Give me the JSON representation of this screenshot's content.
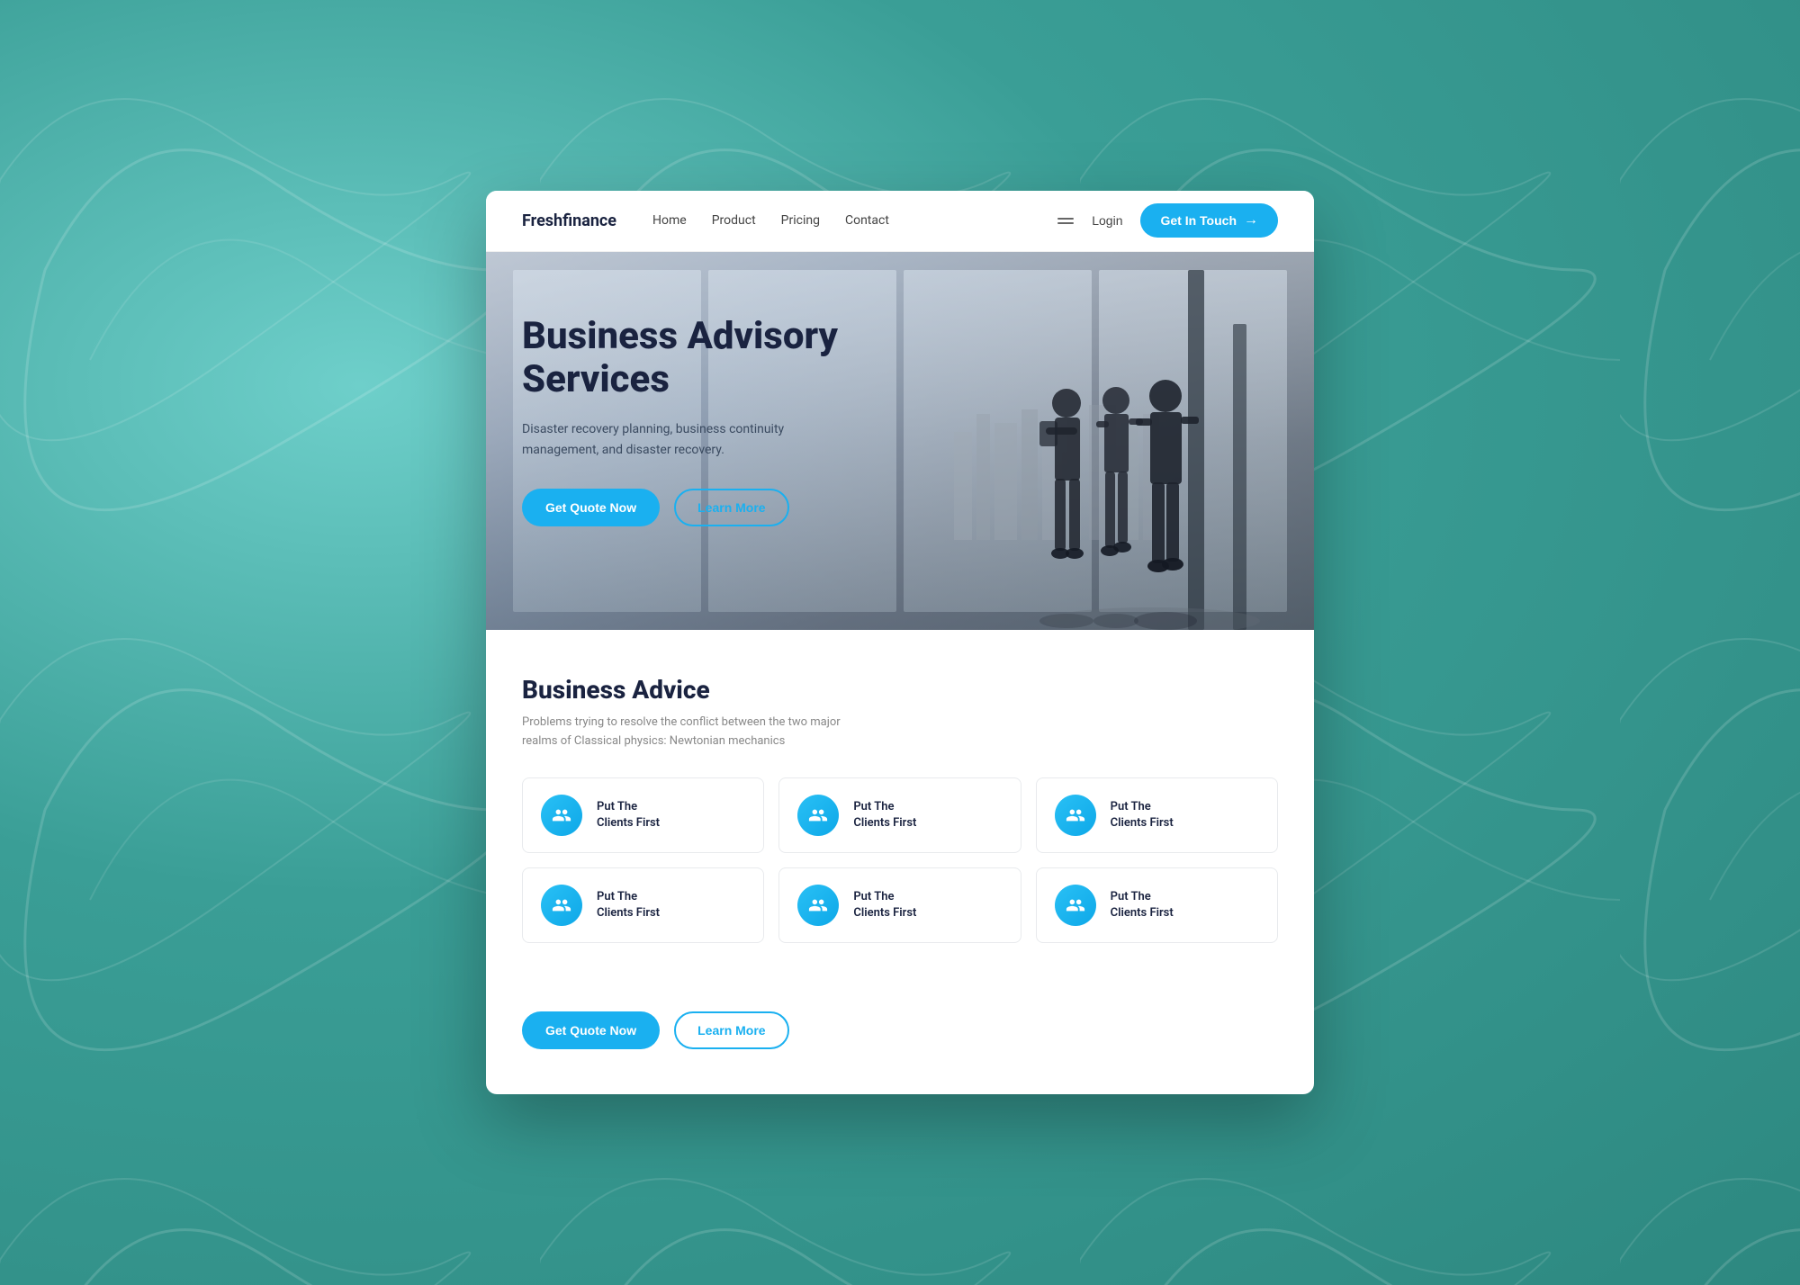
{
  "brand": {
    "name": "Freshfinance"
  },
  "navbar": {
    "links": [
      {
        "label": "Home",
        "id": "home"
      },
      {
        "label": "Product",
        "id": "product"
      },
      {
        "label": "Pricing",
        "id": "pricing"
      },
      {
        "label": "Contact",
        "id": "contact"
      }
    ],
    "login_label": "Login",
    "cta_label": "Get In Touch",
    "cta_arrow": "→"
  },
  "hero": {
    "title": "Business Advisory Services",
    "subtitle": "Disaster recovery planning, business continuity management, and disaster recovery.",
    "btn_quote": "Get Quote Now",
    "btn_learn_more": "Learn More"
  },
  "advice_section": {
    "title": "Business Advice",
    "subtitle": "Problems trying to resolve the conflict between the two major realms of Classical physics: Newtonian mechanics",
    "cards": [
      {
        "label": "Put The\nClients First"
      },
      {
        "label": "Put The\nClients First"
      },
      {
        "label": "Put The\nClients First"
      },
      {
        "label": "Put The\nClients First"
      },
      {
        "label": "Put The\nClients First"
      },
      {
        "label": "Put The\nClients First"
      }
    ],
    "btn_quote": "Get Quote Now",
    "btn_learn_more": "Learn More"
  }
}
